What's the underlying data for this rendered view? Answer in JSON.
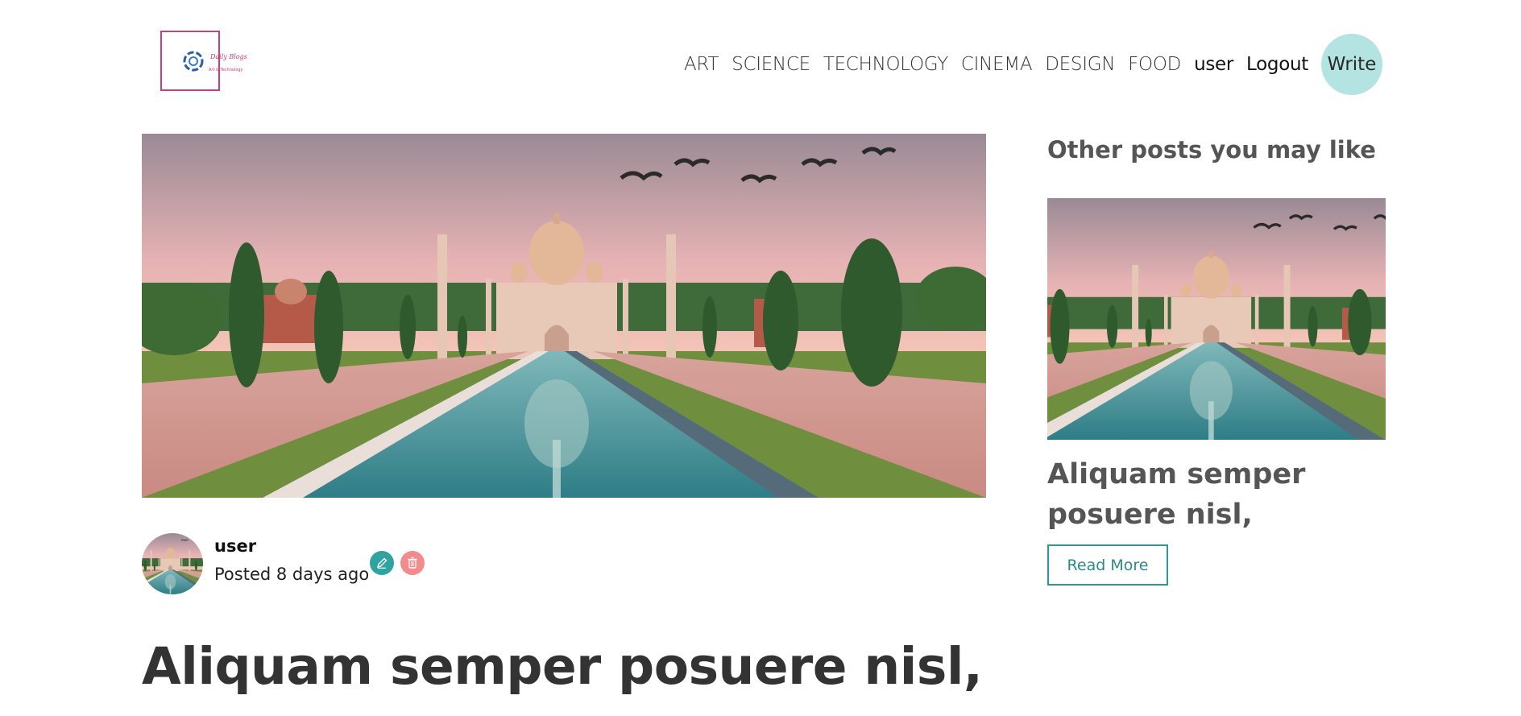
{
  "brand": {
    "logo_line1": "Daily Blogs",
    "logo_line2": "Art & Technology"
  },
  "nav": {
    "items": [
      "ART",
      "SCIENCE",
      "TECHNOLOGY",
      "CINEMA",
      "DESIGN",
      "FOOD"
    ],
    "user_label": "user",
    "logout_label": "Logout",
    "write_label": "Write"
  },
  "post": {
    "author": "user",
    "posted": "Posted 8 days ago",
    "title": "Aliquam semper posuere nisl,",
    "image_alt": "taj-mahal-photo"
  },
  "sidebar": {
    "heading": "Other posts you may like",
    "card": {
      "title": "Aliquam semper posuere nisl,",
      "read_more": "Read More"
    }
  },
  "colors": {
    "accent_teal": "#2fa3a0",
    "write_button_bg": "#b4e4e2",
    "delete_red": "#f28b8b",
    "logo_pink": "#d13b7a"
  }
}
